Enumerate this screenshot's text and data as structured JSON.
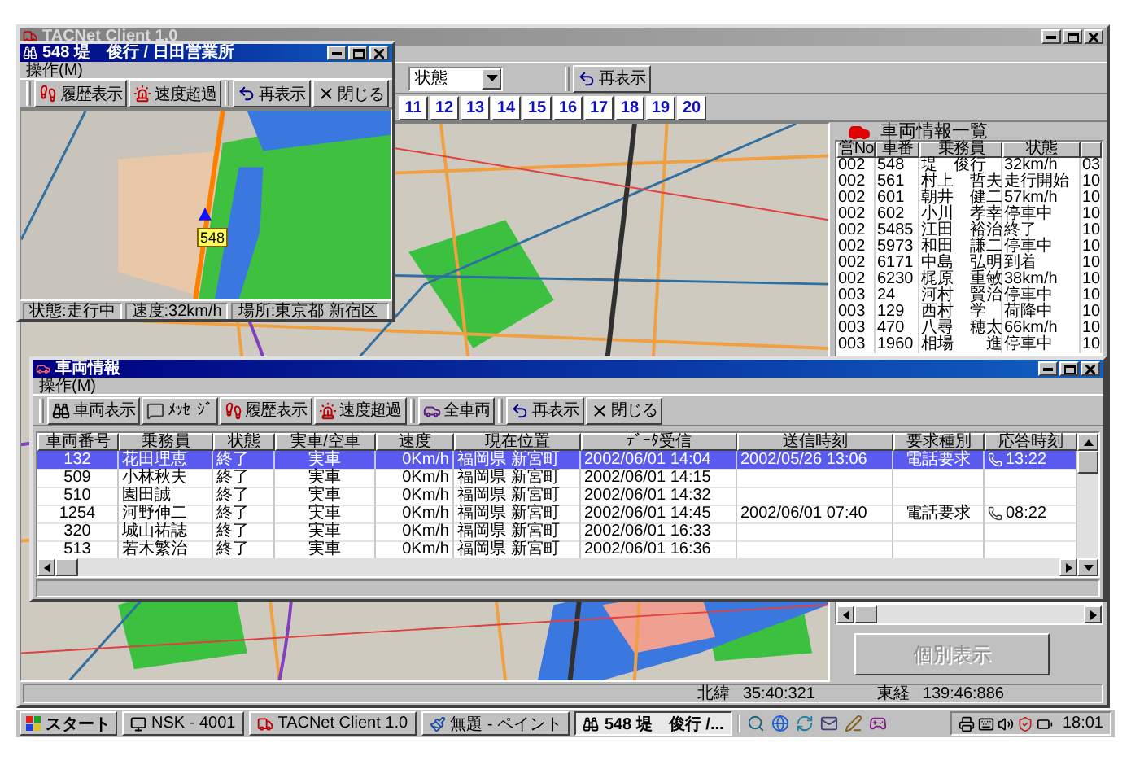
{
  "main_window": {
    "title": "TACNet Client 1.0",
    "toolbar": {
      "filter": "状態",
      "refresh": "再表示"
    },
    "page_tabs": [
      "11",
      "12",
      "13",
      "14",
      "15",
      "16",
      "17",
      "18",
      "19",
      "20"
    ],
    "vehicle_list": {
      "title": "車両情報一覧",
      "columns": [
        "営No",
        "車番",
        "乗務員",
        "状態"
      ],
      "rows": [
        [
          "002",
          "548",
          "堤　俊行",
          "32km/h",
          "03"
        ],
        [
          "002",
          "561",
          "村上　哲夫",
          "走行開始",
          "10"
        ],
        [
          "002",
          "601",
          "朝井　健二",
          "57km/h",
          "10"
        ],
        [
          "002",
          "602",
          "小川　孝幸",
          "停車中",
          "10"
        ],
        [
          "002",
          "5485",
          "江田　裕治",
          "終了",
          "10"
        ],
        [
          "002",
          "5973",
          "和田　謙二",
          "停車中",
          "10"
        ],
        [
          "002",
          "6171",
          "中島　弘明",
          "到着",
          "10"
        ],
        [
          "002",
          "6230",
          "梶原　重敏",
          "38km/h",
          "10"
        ],
        [
          "003",
          "24",
          "河村　賢治",
          "停車中",
          "10"
        ],
        [
          "003",
          "129",
          "西村　学",
          "荷降中",
          "10"
        ],
        [
          "003",
          "470",
          "八尋　穂太",
          "66km/h",
          "10"
        ],
        [
          "003",
          "1960",
          "相場　　進",
          "停車中",
          "10"
        ]
      ]
    },
    "detail_button": {
      "label": "個別表示",
      "disabled": true
    },
    "status_bar": {
      "latitude_label": "北緯",
      "latitude": "35:40:321",
      "longitude_label": "東経",
      "longitude": "139:46:886"
    }
  },
  "vehicle_window": {
    "title": "548 堤　俊行 / 日田営業所",
    "menu": [
      "操作(M)"
    ],
    "toolbar": [
      [
        {
          "label": "履歴表示",
          "kind": "history"
        },
        {
          "label": "速度超過",
          "kind": "speed"
        }
      ],
      [
        {
          "label": "再表示",
          "kind": "refresh"
        },
        {
          "label": "閉じる",
          "kind": "close"
        }
      ]
    ],
    "map_marker": "548",
    "status": [
      "状態:走行中",
      "速度:32km/h",
      "場所:東京都 新宿区"
    ]
  },
  "info_window": {
    "title": "車両情報",
    "menu": [
      "操作(M)"
    ],
    "toolbar": [
      [
        {
          "label": "車両表示",
          "kind": "binoculars"
        },
        {
          "label": "ﾒｯｾｰｼﾞ",
          "kind": "message"
        },
        {
          "label": "履歴表示",
          "kind": "history"
        },
        {
          "label": "速度超過",
          "kind": "speed"
        }
      ],
      [
        {
          "label": "全車両",
          "kind": "fleet"
        }
      ],
      [
        {
          "label": "再表示",
          "kind": "refresh"
        },
        {
          "label": "閉じる",
          "kind": "close"
        }
      ]
    ],
    "table": {
      "columns": [
        "車両番号",
        "乗務員",
        "状態",
        "実車/空車",
        "速度",
        "現在位置",
        "ﾃﾞｰﾀ受信",
        "送信時刻",
        "要求種別",
        "応答時刻"
      ],
      "rows": [
        {
          "selected": true,
          "vehicle": "132",
          "crew": "花田理恵",
          "status": "終了",
          "occupancy": "実車",
          "speed": "0Km/h",
          "location": "福岡県 新宮町",
          "received": "2002/06/01 14:04",
          "sent": "2002/05/26 13:06",
          "request": "電話要求",
          "response": "13:22"
        },
        {
          "selected": false,
          "vehicle": "509",
          "crew": "小林秋夫",
          "status": "終了",
          "occupancy": "実車",
          "speed": "0Km/h",
          "location": "福岡県 新宮町",
          "received": "2002/06/01 14:15"
        },
        {
          "selected": false,
          "vehicle": "510",
          "crew": "園田誠",
          "status": "終了",
          "occupancy": "実車",
          "speed": "0Km/h",
          "location": "福岡県 新宮町",
          "received": "2002/06/01 14:32"
        },
        {
          "selected": false,
          "vehicle": "1254",
          "crew": "河野伸二",
          "status": "終了",
          "occupancy": "実車",
          "speed": "0Km/h",
          "location": "福岡県 新宮町",
          "received": "2002/06/01 14:45",
          "sent": "2002/06/01 07:40",
          "request": "電話要求",
          "response": "08:22"
        },
        {
          "selected": false,
          "vehicle": "320",
          "crew": "城山祐誌",
          "status": "終了",
          "occupancy": "実車",
          "speed": "0Km/h",
          "location": "福岡県 新宮町",
          "received": "2002/06/01 16:33"
        },
        {
          "selected": false,
          "vehicle": "513",
          "crew": "若木繁治",
          "status": "終了",
          "occupancy": "実車",
          "speed": "0Km/h",
          "location": "福岡県 新宮町",
          "received": "2002/06/01 16:36"
        }
      ]
    }
  },
  "taskbar": {
    "start": "スタート",
    "tasks": [
      {
        "label": "NSK - 4001",
        "kind": "terminal",
        "selected": false
      },
      {
        "label": "TACNet Client 1.0",
        "kind": "truck",
        "selected": false
      },
      {
        "label": "無題 - ペイント",
        "kind": "paint",
        "selected": false
      },
      {
        "label": "548 堤　俊行 /...",
        "kind": "binoculars",
        "selected": true
      }
    ],
    "clock": "18:01"
  }
}
